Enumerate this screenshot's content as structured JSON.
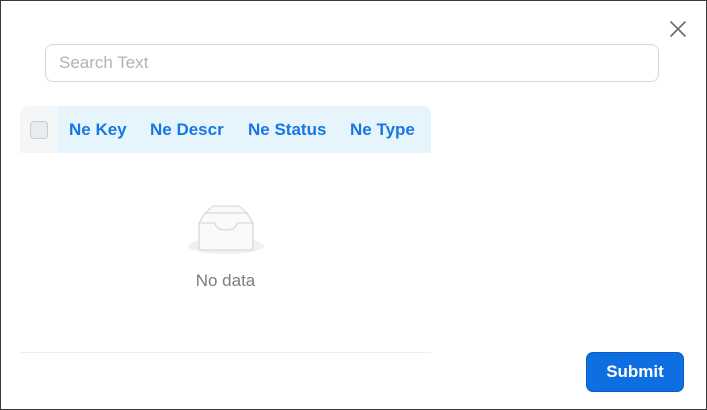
{
  "search": {
    "placeholder": "Search Text",
    "value": ""
  },
  "table": {
    "columns": [
      "Ne Key",
      "Ne Descr",
      "Ne Status",
      "Ne Type"
    ],
    "rows": [],
    "empty_text": "No data"
  },
  "footer": {
    "submit_label": "Submit"
  },
  "icons": {
    "close": "close-icon",
    "empty": "empty-inbox-icon"
  },
  "colors": {
    "accent": "#1877e0",
    "header_bg": "#e6f4fc",
    "button_bg": "#0e6fe3"
  }
}
